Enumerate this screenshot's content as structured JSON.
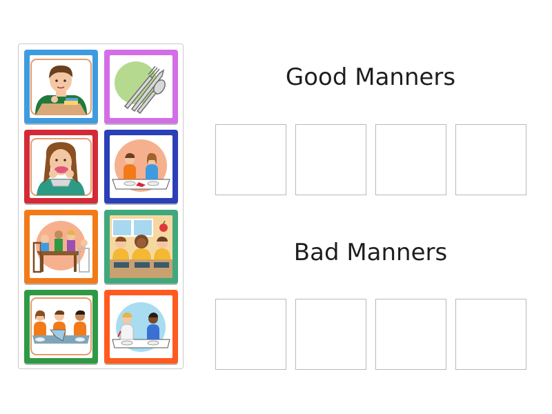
{
  "tray": {
    "cards": [
      {
        "id": "boy-wiping-mouth",
        "frame_color": "#3e9be0"
      },
      {
        "id": "cutlery",
        "frame_color": "#d36ee6"
      },
      {
        "id": "girl-eating-messily",
        "frame_color": "#d42a37"
      },
      {
        "id": "children-at-table-spill",
        "frame_color": "#2a3fb8"
      },
      {
        "id": "family-dinner",
        "frame_color": "#f27a18"
      },
      {
        "id": "school-cafeteria",
        "frame_color": "#3fa87c"
      },
      {
        "id": "kids-sharing-food",
        "frame_color": "#2f9944"
      },
      {
        "id": "two-kids-eating",
        "frame_color": "#ff5a1f"
      }
    ]
  },
  "groups": [
    {
      "title": "Good Manners",
      "slots": 4
    },
    {
      "title": "Bad Manners",
      "slots": 4
    }
  ]
}
